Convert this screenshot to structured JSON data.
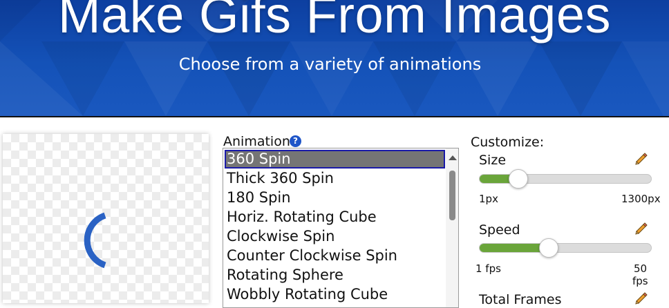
{
  "hero": {
    "title": "Make Gifs From Images",
    "subtitle": "Choose from a variety of animations"
  },
  "preview": {
    "icon": "spinner-arc-icon",
    "accent_color": "#2a62c4"
  },
  "animation": {
    "label": "Animation:",
    "help_icon": "?",
    "selected": "360 Spin",
    "options": [
      "360 Spin",
      "Thick 360 Spin",
      "180 Spin",
      "Horiz. Rotating Cube",
      "Clockwise Spin",
      "Counter Clockwise Spin",
      "Rotating Sphere",
      "Wobbly Rotating Cube"
    ]
  },
  "customize": {
    "title": "Customize:",
    "size": {
      "label": "Size",
      "min_label": "1px",
      "max_label": "1300px",
      "value_fraction": 0.22
    },
    "speed": {
      "label": "Speed",
      "min_label": "1 fps",
      "max_label_line1": "50",
      "max_label_line2": "fps",
      "value_fraction": 0.4
    },
    "total_frames": {
      "label": "Total Frames"
    },
    "accent_color": "#6aa53a"
  }
}
